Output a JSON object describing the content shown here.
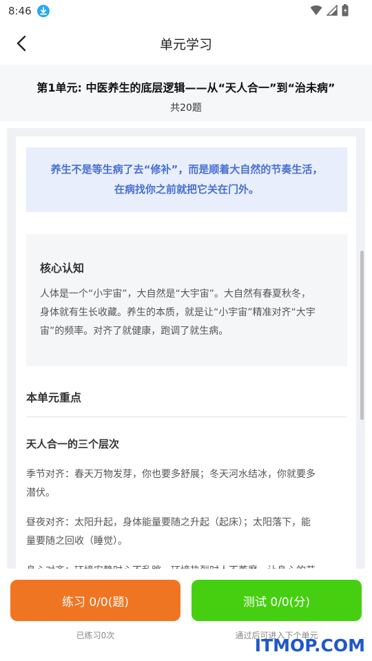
{
  "status_bar": {
    "time": "8:46",
    "icons": [
      "download-icon",
      "wifi-icon",
      "signal-icon",
      "battery-icon"
    ]
  },
  "nav": {
    "title": "单元学习",
    "back_icon": "chevron-left-icon"
  },
  "unit": {
    "title": "第1单元: 中医养生的底层逻辑——从“天人合一”到“治未病”",
    "count": "共20题"
  },
  "quote": {
    "line1": "养生不是等生病了去“修补”，而是顺着大自然的节奏生活，",
    "line2": "在病找你之前就把它关在门外。"
  },
  "core": {
    "title": "核心认知",
    "lines": [
      "人体是一个“小宇宙”，大自然是“大宇宙”。大自然有春夏秋冬，",
      "身体就有生长收藏。养生的本质，就是让“小宇宙”精准对齐“大宇",
      "宙”的频率。对齐了就健康，跑调了就生病。"
    ]
  },
  "key_points": {
    "title": "本单元重点",
    "subtitle": "天人合一的三个层次",
    "para1": [
      "季节对齐：春天万物发芽，你也要多舒展；冬天河水结冰，你就要多",
      "潜伏。"
    ],
    "para2": [
      "昼夜对齐：太阳升起，身体能量要随之升起（起床）；太阳落下，能",
      "量要随之回收（睡觉）。"
    ],
    "para3_partial": "身心对齐：环境安静时心不乱跳，环境热烈时人不萎靡，让身心的节"
  },
  "actions": {
    "practice_label": "练习 0/0(题)",
    "practice_note": "已练习0次",
    "test_label": "测试 0/0(分)",
    "test_note": "通过后可进入下个单元"
  },
  "watermark": "ITMOP.COM",
  "colors": {
    "practice_button": "#f07522",
    "test_button": "#46cf11",
    "quote_text": "#4a70cf",
    "quote_bg": "#e8eefb"
  }
}
